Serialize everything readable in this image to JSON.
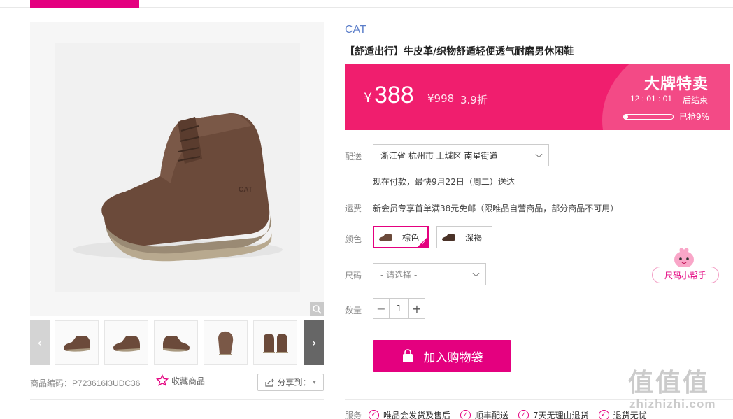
{
  "gallery": {
    "sku_text": "商品编码：P723616I3UDC36",
    "favorite_label": "收藏商品",
    "share_label": "分享到：",
    "thumbs": [
      "shoe-side",
      "shoe-side",
      "shoe-side",
      "shoe-back",
      "shoe-pair"
    ]
  },
  "product": {
    "brand": "CAT",
    "title": "【舒适出行】牛皮革/织物舒适轻便透气耐磨男休闲鞋"
  },
  "price": {
    "currency": "¥",
    "current": "388",
    "original": "¥998",
    "discount": "3.9折",
    "promo_title": "大牌特卖",
    "countdown": "12 : 01 : 01",
    "ends_label": "后结束",
    "sold_label": "已抢9%",
    "sold_fraction": 0.09,
    "accent_color": "#f01e6e"
  },
  "delivery": {
    "label": "配送",
    "address": "浙江省 杭州市 上城区 南星街道",
    "eta": "现在付款，最快9月22日（周二）送达"
  },
  "shipping": {
    "label": "运费",
    "text": "新会员专享首单满38元免邮（限唯品自营商品，部分商品不可用）"
  },
  "color": {
    "label": "颜色",
    "options": [
      {
        "name": "棕色",
        "selected": true
      },
      {
        "name": "深褐",
        "selected": false
      }
    ]
  },
  "size": {
    "label": "尺码",
    "placeholder": "- 请选择 -",
    "helper_label": "尺码小帮手"
  },
  "quantity": {
    "label": "数量",
    "value": "1",
    "minus": "−",
    "plus": "+"
  },
  "cart": {
    "label": "加入购物袋"
  },
  "services": {
    "label": "服务",
    "items": [
      "唯品会发货及售后",
      "顺丰配送",
      "7天无理由退货",
      "退货无忧"
    ]
  },
  "watermark": {
    "line1": "值值值",
    "line2": "zhizhizhi.com"
  }
}
